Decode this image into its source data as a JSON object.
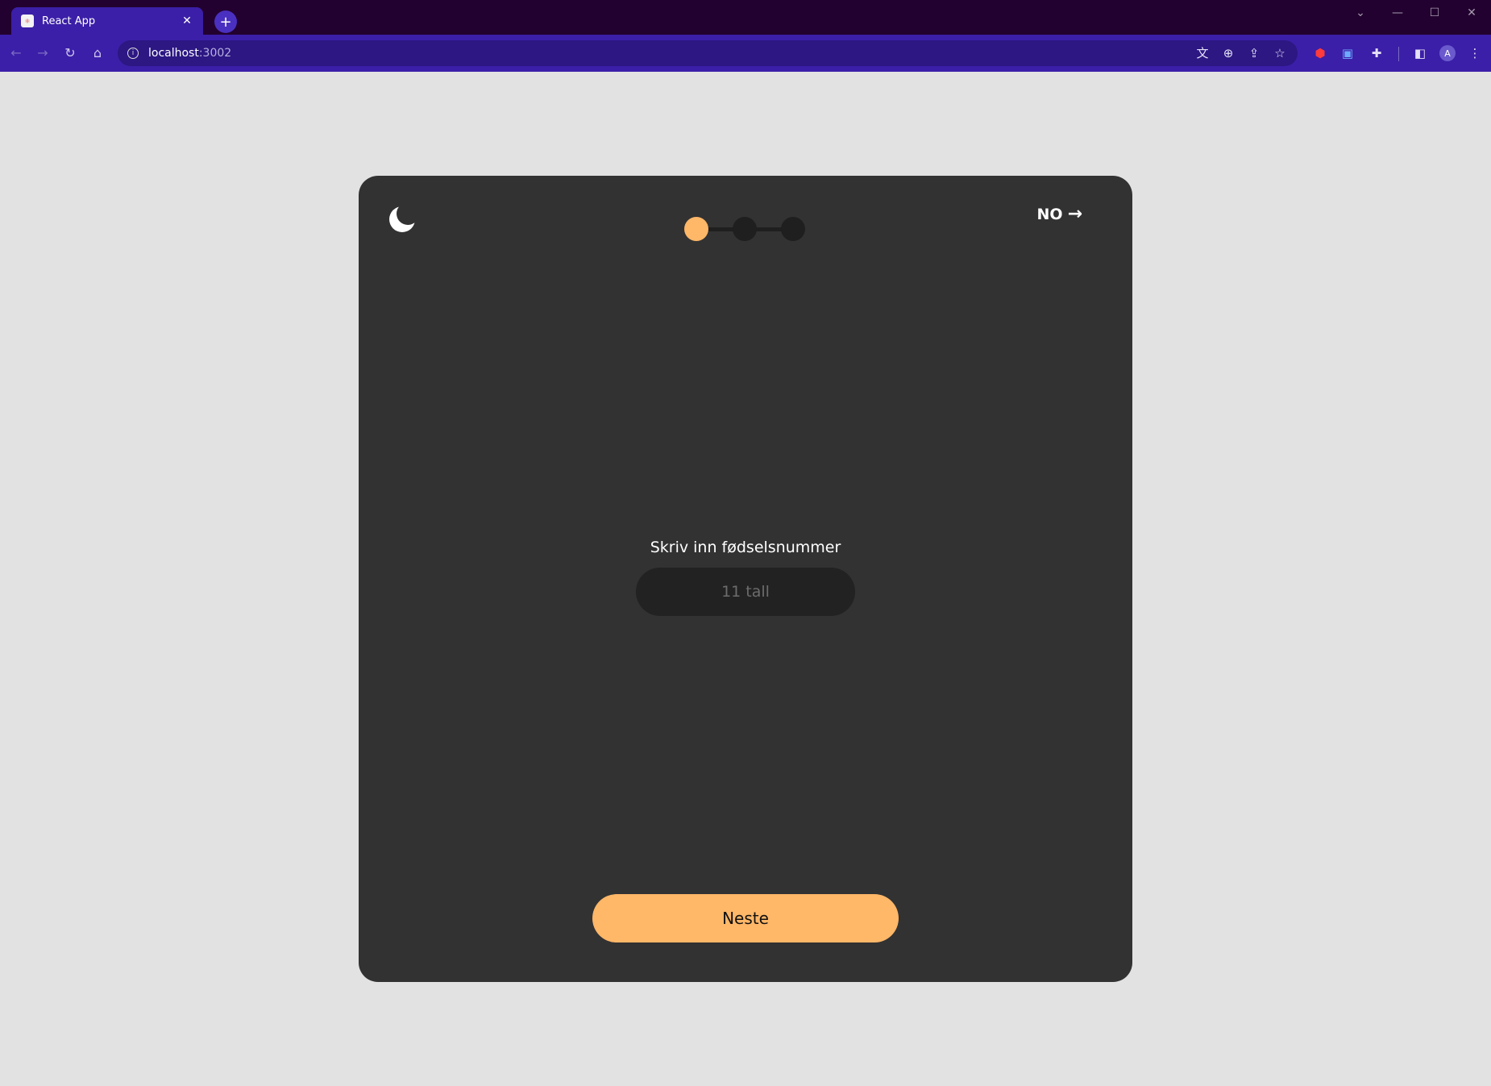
{
  "browser": {
    "tab": {
      "title": "React App",
      "favicon": "react-app-favicon",
      "close": "✕"
    },
    "new_tab": "+",
    "address": {
      "host": "localhost",
      "port": ":3002"
    },
    "window_controls": {
      "menu": "⌄",
      "minimize": "—",
      "maximize": "☐",
      "close": "✕"
    }
  },
  "page": {
    "theme_toggle": "moon-icon",
    "language": {
      "label": "NO",
      "arrow": "→"
    },
    "stepper": {
      "total_steps": 3,
      "current_step": 1,
      "active_color": "#ffb768"
    },
    "form": {
      "label": "Skriv inn fødselsnummer",
      "placeholder": "11 tall",
      "value": ""
    },
    "next_button": "Neste"
  },
  "colors": {
    "accent": "#ffb768",
    "card": "#323232",
    "background": "#e2e2e2",
    "browser_frame": "#3b1fa8"
  }
}
